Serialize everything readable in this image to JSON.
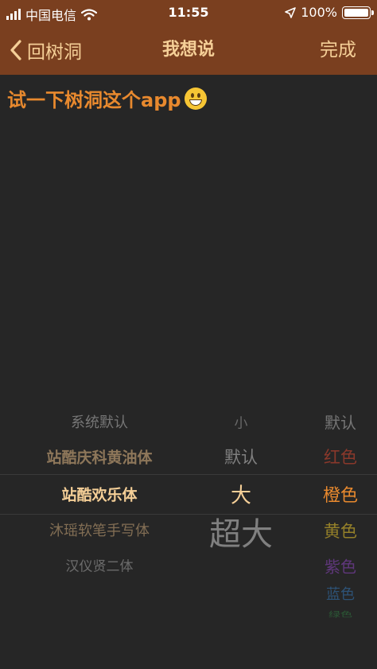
{
  "status_bar": {
    "carrier": "中国电信",
    "time": "11:55",
    "battery": "100%",
    "battery_level": 1.0
  },
  "nav": {
    "back_label": "回树洞",
    "title": "我想说",
    "done_label": "完成"
  },
  "post_text": "试一下树洞这个app",
  "pickers": {
    "fonts": [
      "系统默认",
      "站酷庆科黄油体",
      "站酷欢乐体",
      "沐瑶软笔手写体",
      "汉仪贤二体"
    ],
    "sizes": [
      "小",
      "默认",
      "大",
      "超大"
    ],
    "colors": [
      "默认",
      "红色",
      "橙色",
      "黄色",
      "紫色",
      "蓝色",
      "绿色"
    ]
  },
  "colors": {
    "nav_bg": "#7a3f1f",
    "nav_text": "#f5cf97",
    "text_orange": "#e8892e",
    "background": "#262626"
  }
}
